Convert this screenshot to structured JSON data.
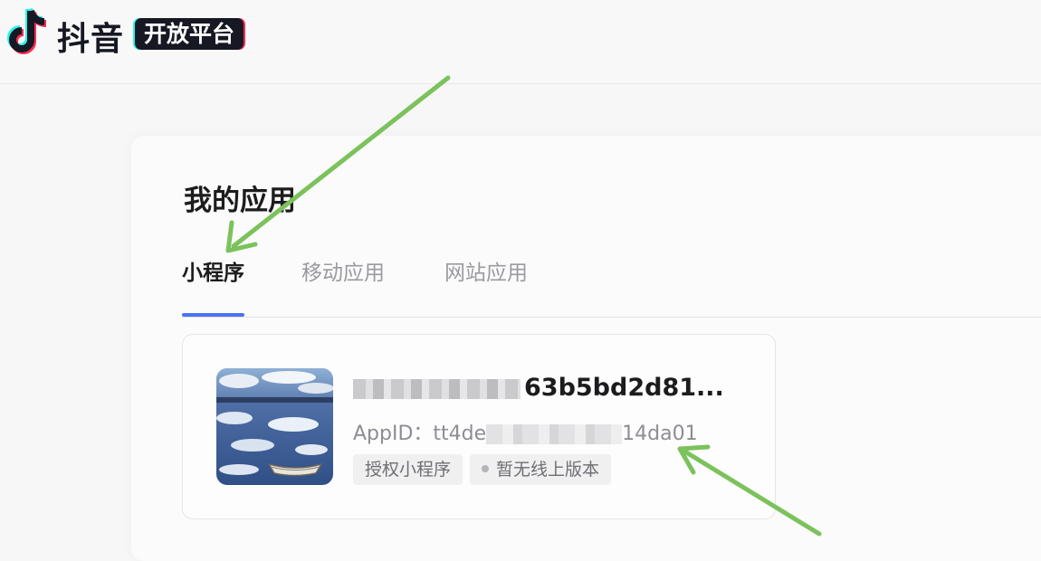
{
  "header": {
    "brand_name": "抖音",
    "brand_badge": "开放平台",
    "logo_icon": "douyin-logo-icon"
  },
  "main": {
    "title": "我的应用",
    "tabs": [
      {
        "label": "小程序",
        "active": true
      },
      {
        "label": "移动应用",
        "active": false
      },
      {
        "label": "网站应用",
        "active": false
      }
    ],
    "app_card": {
      "name_visible_suffix": "63b5bd2d81...",
      "appid_label": "AppID：",
      "appid_prefix": "tt4de",
      "appid_suffix": "14da01",
      "tags": [
        {
          "label": "授权小程序"
        },
        {
          "label": "暂无线上版本"
        }
      ]
    }
  },
  "colors": {
    "accent": "#4a72f5",
    "annotation_arrow": "#7cc25c",
    "brand_dark": "#161823"
  }
}
